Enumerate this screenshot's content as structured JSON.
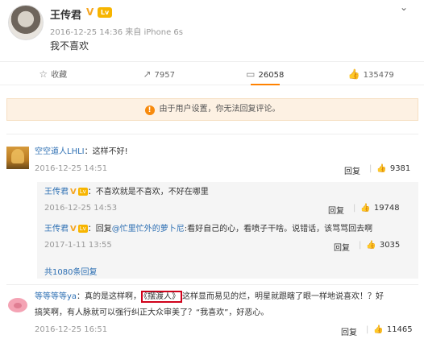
{
  "post": {
    "author": "王传君",
    "verified_mark": "V",
    "level_badge": "Lv",
    "meta": "2016-12-25 14:36 来自 iPhone 6s",
    "text": "我不喜欢"
  },
  "actions": [
    {
      "icon": "star-icon",
      "glyph": "☆",
      "label": "收藏"
    },
    {
      "icon": "repost-icon",
      "glyph": "↗",
      "label": "7957"
    },
    {
      "icon": "comment-icon",
      "glyph": "▭",
      "label": "26058"
    },
    {
      "icon": "like-icon",
      "glyph": "👍",
      "label": "135479"
    }
  ],
  "notice": {
    "glyph": "!",
    "text": "由于用户设置，你无法回复评论。"
  },
  "comments": [
    {
      "user": "空空道人LHLI",
      "text": "：这样不好!",
      "time": "2016-12-25 14:51",
      "reply": "回复",
      "likes": "9381"
    },
    {
      "user": "等等等等ya",
      "text_before": "：真的是这样啊，",
      "highlight": "《摆渡人》",
      "text_after": "这样显而易见的烂，明星就跟瞎了眼一样地说喜欢！？好",
      "text_line2": "搞笑啊，有人脉就可以强行纠正大众审美了？“我喜欢”，好恶心。",
      "time": "2016-12-25 16:51",
      "reply": "回复",
      "likes": "11465"
    }
  ],
  "replies": [
    {
      "user": "王传君",
      "text": "：不喜欢就是不喜欢，不好在哪里",
      "time": "2016-12-25 14:53",
      "reply": "回复",
      "likes": "19748"
    },
    {
      "user": "王传君",
      "text_prefix": "：回复",
      "mention": "@忙里忙外的萝卜尼",
      "text": ":看好自己的心，看喷子干啥。说错话，该骂骂回去啊",
      "time": "2017-1-11 13:55",
      "reply": "回复",
      "likes": "3035"
    }
  ],
  "more_replies": "共1080条回复",
  "chevron_glyph": "⌄",
  "like_glyph": "👍",
  "colors": {
    "accent": "#ff8200",
    "link": "#2d6fb3",
    "notice_bg": "#fdf1e3",
    "highlight_box": "#d0021b"
  }
}
